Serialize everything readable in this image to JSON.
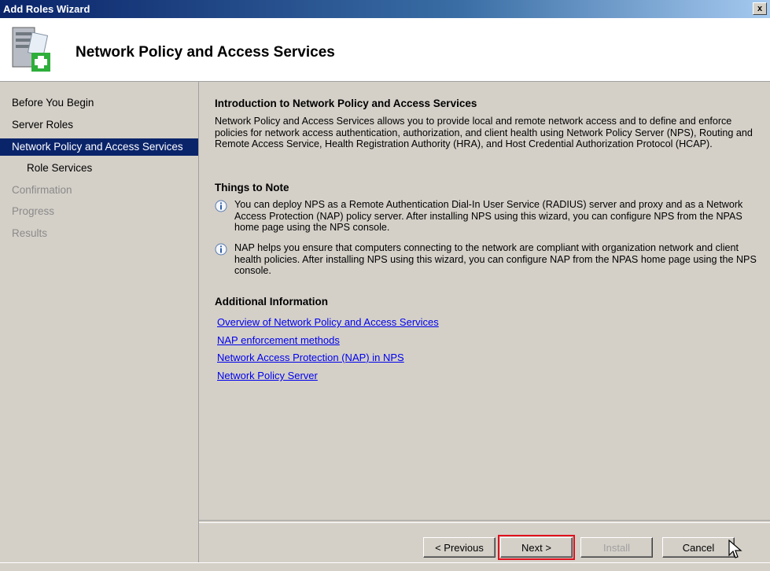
{
  "window": {
    "title": "Add Roles Wizard",
    "close_label": "x"
  },
  "header": {
    "title": "Network Policy and Access Services",
    "icon": "server-add-icon"
  },
  "sidebar": {
    "items": [
      {
        "label": "Before You Begin",
        "state": "normal"
      },
      {
        "label": "Server Roles",
        "state": "normal"
      },
      {
        "label": "Network Policy and Access Services",
        "state": "active"
      },
      {
        "label": "Role Services",
        "state": "sub"
      },
      {
        "label": "Confirmation",
        "state": "disabled"
      },
      {
        "label": "Progress",
        "state": "disabled"
      },
      {
        "label": "Results",
        "state": "disabled"
      }
    ]
  },
  "main": {
    "intro_title": "Introduction to Network Policy and Access Services",
    "intro_text": "Network Policy and Access Services allows you to provide local and remote network access and to define and enforce policies for network access authentication, authorization, and client health using Network Policy Server (NPS), Routing and Remote Access Service, Health Registration Authority (HRA), and Host Credential Authorization Protocol (HCAP).",
    "notes_title": "Things to Note",
    "notes": [
      "You can deploy NPS as a Remote Authentication Dial-In User Service (RADIUS) server and proxy and as a Network Access Protection (NAP) policy server. After installing NPS using this wizard, you can configure NPS from the NPAS home page using the NPS console.",
      "NAP helps you ensure that computers connecting to the network are compliant with organization network and client health policies. After installing NPS using this wizard, you can configure NAP from the NPAS home page using the NPS console."
    ],
    "additional_title": "Additional Information",
    "links": [
      "Overview of Network Policy and Access Services",
      "NAP enforcement methods",
      "Network Access Protection (NAP) in NPS",
      "Network Policy Server"
    ]
  },
  "buttons": {
    "previous": "< Previous",
    "next": "Next >",
    "install": "Install",
    "cancel": "Cancel"
  },
  "colors": {
    "accent": "#0a246a",
    "highlight_border": "#e0101c",
    "link": "#0000ee"
  }
}
